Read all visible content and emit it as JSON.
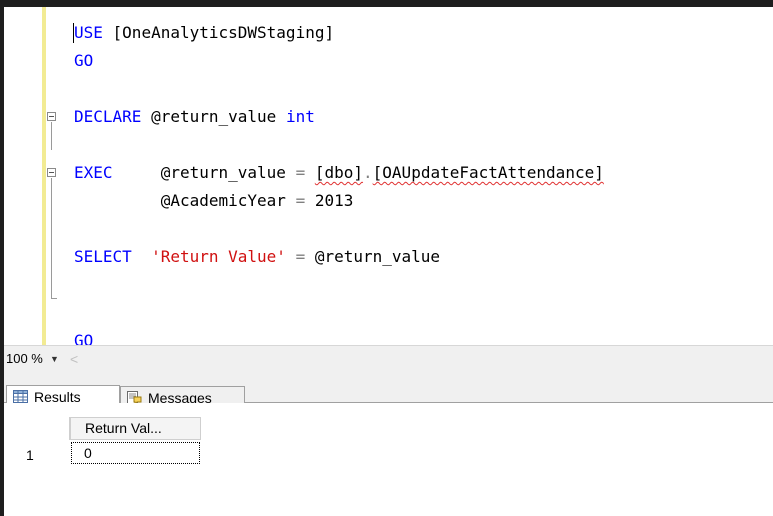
{
  "editor": {
    "lines": [
      {
        "parts": [
          {
            "t": "USE",
            "c": "kw"
          },
          {
            "t": " [OneAnalyticsDWStaging]",
            "c": ""
          }
        ]
      },
      {
        "parts": [
          {
            "t": "GO",
            "c": "kw"
          }
        ]
      },
      {
        "parts": []
      },
      {
        "parts": [
          {
            "t": "DECLARE",
            "c": "kw"
          },
          {
            "t": " @return_value ",
            "c": ""
          },
          {
            "t": "int",
            "c": "kw"
          }
        ]
      },
      {
        "parts": []
      },
      {
        "parts": [
          {
            "t": "EXEC",
            "c": "kw"
          },
          {
            "t": "     @return_value ",
            "c": ""
          },
          {
            "t": "=",
            "c": "op"
          },
          {
            "t": " ",
            "c": ""
          },
          {
            "t": "[dbo]",
            "c": "squig"
          },
          {
            "t": ".",
            "c": "op"
          },
          {
            "t": "[OAUpdateFactAttendance]",
            "c": "squig"
          }
        ]
      },
      {
        "parts": [
          {
            "t": "         @AcademicYear ",
            "c": ""
          },
          {
            "t": "=",
            "c": "op"
          },
          {
            "t": " 2013",
            "c": ""
          }
        ]
      },
      {
        "parts": []
      },
      {
        "parts": [
          {
            "t": "SELECT",
            "c": "kw"
          },
          {
            "t": "  ",
            "c": ""
          },
          {
            "t": "'Return Value'",
            "c": "str"
          },
          {
            "t": " ",
            "c": ""
          },
          {
            "t": "=",
            "c": "op"
          },
          {
            "t": " @return_value",
            "c": ""
          }
        ]
      },
      {
        "parts": []
      },
      {
        "parts": []
      },
      {
        "parts": [
          {
            "t": "GO",
            "c": "kw"
          }
        ]
      }
    ]
  },
  "statusbar": {
    "zoom_label": "100 %",
    "scroll_left_glyph": "<"
  },
  "tabs": [
    {
      "label": "Results",
      "icon": "grid-icon",
      "active": true
    },
    {
      "label": "Messages",
      "icon": "messages-icon",
      "active": false
    }
  ],
  "results": {
    "column_header": "Return Val...",
    "rows": [
      {
        "num": "1",
        "value": "0"
      }
    ]
  }
}
